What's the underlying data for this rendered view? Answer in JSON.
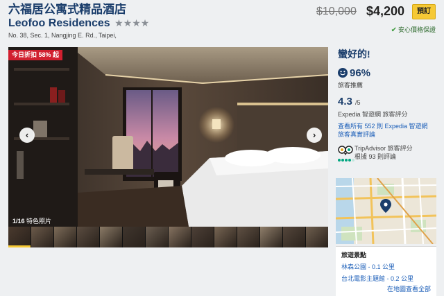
{
  "header": {
    "title": "六福居公寓式精品酒店",
    "name_en": "Leofoo Residences",
    "stars": "★★★★",
    "address": "No. 38, Sec. 1, Nangjing E. Rd.,  Taipei,"
  },
  "pricing": {
    "old_price": "$10,000",
    "new_price": "$4,200",
    "book_label": "預訂",
    "guarantee": "安心價格保證"
  },
  "gallery": {
    "deal_badge": "今日折扣 58% 起",
    "counter": "1/16",
    "counter_label": "特色照片",
    "thumbnail_count": 14,
    "selected_thumbnail": 1
  },
  "reviews": {
    "headline": "蠻好的!",
    "recommend_pct": "96%",
    "recommend_label": "旅客推薦",
    "score": "4.3",
    "score_of": "/5",
    "score_source": "Expedia 智遊網 旅客評分",
    "all_reviews_link": "查看所有 552 則 Expedia 智遊網 旅客真實評論",
    "tripadvisor_label": "TripAdvisor 旅客評分",
    "tripadvisor_count": "根據 93 則評論",
    "tripadvisor_rating": 4
  },
  "attractions": {
    "title": "旅遊景點",
    "items": [
      "林森公園 - 0.1 公里",
      "台北電影主題館 - 0.2 公里"
    ],
    "more_link": "在地圖查看全部"
  },
  "colors": {
    "brand_navy": "#1a3d6b",
    "book_yellow": "#f6c935",
    "deal_red": "#d11f2f",
    "link_blue": "#1b5eb8",
    "guarantee_green": "#2d6a2d",
    "tripadvisor_green": "#00a680"
  },
  "icons": [
    "check-icon",
    "smile-icon",
    "chevron-left-icon",
    "chevron-right-icon",
    "tripadvisor-owl-icon",
    "map-pin-icon"
  ]
}
